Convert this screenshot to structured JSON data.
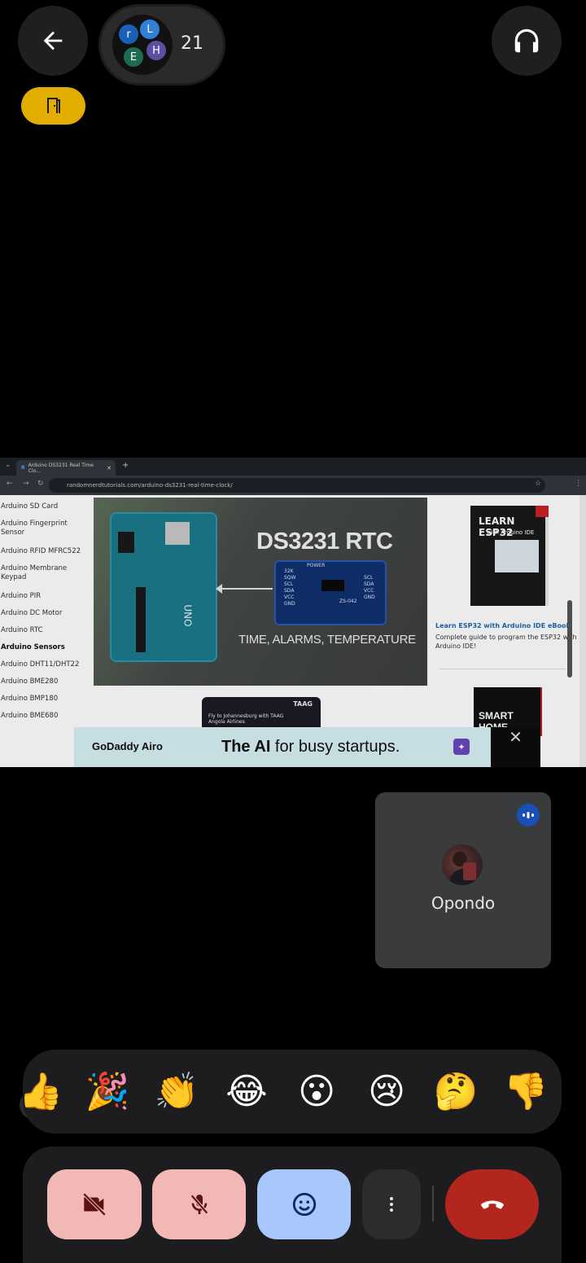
{
  "header": {
    "participant_initials": [
      "r",
      "L",
      "E",
      "H"
    ],
    "participant_count": "21"
  },
  "shared_screen": {
    "tab_favicon": "R",
    "tab_title": "Arduino DS3231 Real Time Clo...",
    "url": "randomnerdtutorials.com/arduino-ds3231-real-time-clock/",
    "sidebar": [
      "Arduino SD Card",
      "Arduino Fingerprint Sensor",
      "Arduino RFID MFRC522",
      "Arduino Membrane Keypad",
      "Arduino PIR",
      "Arduino DC Motor",
      "Arduino RTC",
      "Arduino Sensors",
      "Arduino DHT11/DHT22",
      "Arduino BME280",
      "Arduino BMP180",
      "Arduino BME680"
    ],
    "hero_title": "DS3231 RTC",
    "hero_subtitle": "TIME, ALARMS, TEMPERATURE",
    "module_label": "ZS-042",
    "module_pins_left": [
      "32K",
      "SQW",
      "SCL",
      "SDA",
      "VCC",
      "GND"
    ],
    "module_pins_right": [
      "SCL",
      "SDA",
      "VCC",
      "GND"
    ],
    "module_power": "POWER",
    "book_title": "LEARN ESP32",
    "book_subtitle": "with Arduino IDE",
    "book_link": "Learn ESP32 with Arduino IDE eBook",
    "book_desc": "Complete guide to program the ESP32 with Arduino IDE!",
    "book2_title": "SMART HOME",
    "small_ad_text": "Fly to Johannesburg with TAAG Angola Airlines",
    "small_ad_brand": "TAAG",
    "ad_logo": "GoDaddy Airo",
    "ad_text_bold": "The AI",
    "ad_text_rest": " for busy startups."
  },
  "tile": {
    "name": "Opondo"
  },
  "reactions": [
    "👍",
    "🎉",
    "👏",
    "😂",
    "😮",
    "😢",
    "🤔",
    "👎"
  ],
  "colors": {
    "leave_chip": "#e3ad00",
    "hangup": "#b3261e",
    "off_buttons": "#f2b8b5",
    "emoji_button": "#a8c7fa"
  },
  "icons": {
    "back": "arrow-left-icon",
    "audio": "headphones-icon",
    "leave": "door-icon",
    "camera": "videocam-off-icon",
    "mic": "mic-off-icon",
    "emoji": "smile-icon",
    "more": "more-vert-icon",
    "hangup": "call-end-icon"
  }
}
